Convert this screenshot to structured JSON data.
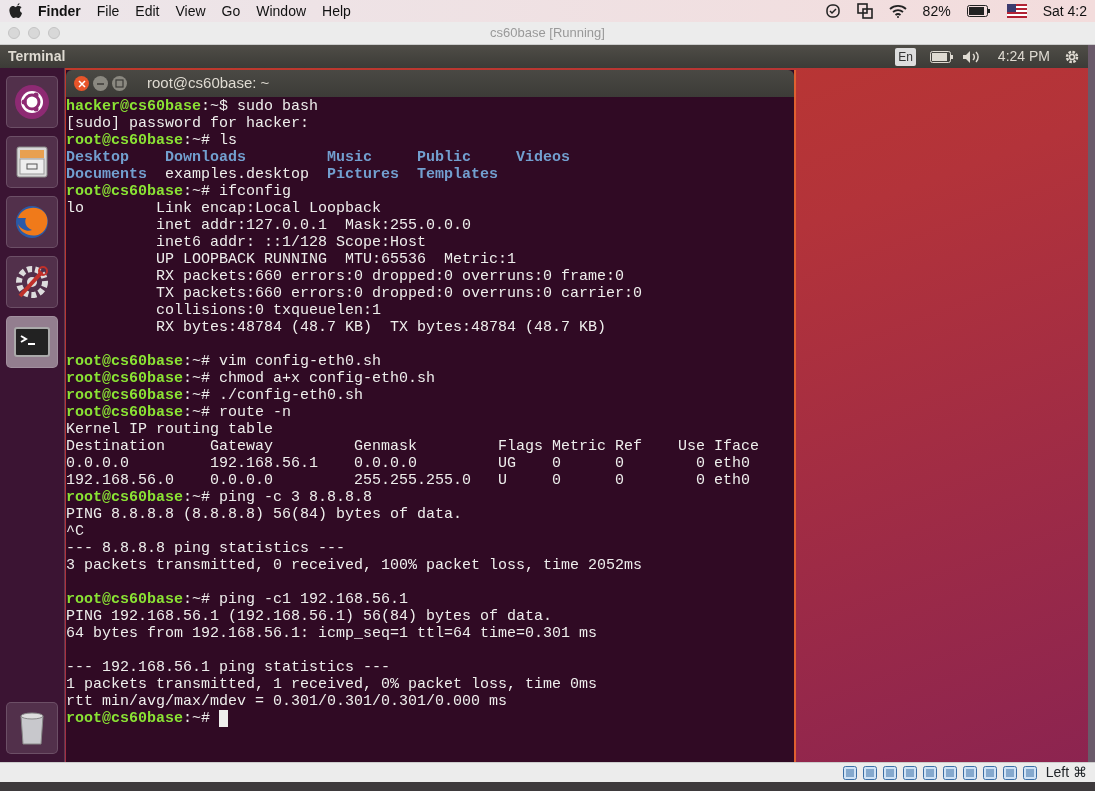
{
  "menubar": {
    "app": "Finder",
    "menus": [
      "File",
      "Edit",
      "View",
      "Go",
      "Window",
      "Help"
    ],
    "battery": "82%",
    "clock": "Sat 4:2"
  },
  "vm_window": {
    "title": "cs60base [Running]"
  },
  "top_panel": {
    "app": "Terminal",
    "keyboard": "En",
    "clock": "4:24 PM"
  },
  "launcher": [
    {
      "kind": "dash",
      "selected": false
    },
    {
      "kind": "files",
      "selected": false
    },
    {
      "kind": "browser",
      "selected": false
    },
    {
      "kind": "settings",
      "selected": false
    },
    {
      "kind": "terminal",
      "selected": true
    },
    {
      "kind": "trash",
      "selected": false
    }
  ],
  "terminal": {
    "title": "root@cs60base: ~",
    "lines": [
      {
        "kind": "prompt",
        "user": "hacker@cs60base",
        "text": ":~$ sudo bash"
      },
      {
        "kind": "output",
        "text": "[sudo] password for hacker:"
      },
      {
        "kind": "prompt",
        "user": "root@cs60base",
        "text": ":~# ls"
      },
      {
        "kind": "listing",
        "items": [
          {
            "text": "Desktop",
            "dir": true
          },
          {
            "text": "Downloads",
            "dir": true
          },
          {
            "text": "Music",
            "dir": true
          },
          {
            "text": "Public",
            "dir": true
          },
          {
            "text": "Videos",
            "dir": true
          }
        ]
      },
      {
        "kind": "listing",
        "items": [
          {
            "text": "Documents",
            "dir": true
          },
          {
            "text": "examples.desktop",
            "dir": false
          },
          {
            "text": "Pictures",
            "dir": true
          },
          {
            "text": "Templates",
            "dir": true
          }
        ]
      },
      {
        "kind": "prompt",
        "user": "root@cs60base",
        "text": ":~# ifconfig"
      },
      {
        "kind": "output",
        "text": "lo        Link encap:Local Loopback"
      },
      {
        "kind": "output",
        "text": "          inet addr:127.0.0.1  Mask:255.0.0.0"
      },
      {
        "kind": "output",
        "text": "          inet6 addr: ::1/128 Scope:Host"
      },
      {
        "kind": "output",
        "text": "          UP LOOPBACK RUNNING  MTU:65536  Metric:1"
      },
      {
        "kind": "output",
        "text": "          RX packets:660 errors:0 dropped:0 overruns:0 frame:0"
      },
      {
        "kind": "output",
        "text": "          TX packets:660 errors:0 dropped:0 overruns:0 carrier:0"
      },
      {
        "kind": "output",
        "text": "          collisions:0 txqueuelen:1"
      },
      {
        "kind": "output",
        "text": "          RX bytes:48784 (48.7 KB)  TX bytes:48784 (48.7 KB)"
      },
      {
        "kind": "blank"
      },
      {
        "kind": "prompt",
        "user": "root@cs60base",
        "text": ":~# vim config-eth0.sh"
      },
      {
        "kind": "prompt",
        "user": "root@cs60base",
        "text": ":~# chmod a+x config-eth0.sh"
      },
      {
        "kind": "prompt",
        "user": "root@cs60base",
        "text": ":~# ./config-eth0.sh"
      },
      {
        "kind": "prompt",
        "user": "root@cs60base",
        "text": ":~# route -n"
      },
      {
        "kind": "output",
        "text": "Kernel IP routing table"
      },
      {
        "kind": "output",
        "text": "Destination     Gateway         Genmask         Flags Metric Ref    Use Iface"
      },
      {
        "kind": "output",
        "text": "0.0.0.0         192.168.56.1    0.0.0.0         UG    0      0        0 eth0"
      },
      {
        "kind": "output",
        "text": "192.168.56.0    0.0.0.0         255.255.255.0   U     0      0        0 eth0"
      },
      {
        "kind": "prompt",
        "user": "root@cs60base",
        "text": ":~# ping -c 3 8.8.8.8"
      },
      {
        "kind": "output",
        "text": "PING 8.8.8.8 (8.8.8.8) 56(84) bytes of data."
      },
      {
        "kind": "output",
        "text": "^C"
      },
      {
        "kind": "output",
        "text": "--- 8.8.8.8 ping statistics ---"
      },
      {
        "kind": "output",
        "text": "3 packets transmitted, 0 received, 100% packet loss, time 2052ms"
      },
      {
        "kind": "blank"
      },
      {
        "kind": "prompt",
        "user": "root@cs60base",
        "text": ":~# ping -c1 192.168.56.1"
      },
      {
        "kind": "output",
        "text": "PING 192.168.56.1 (192.168.56.1) 56(84) bytes of data."
      },
      {
        "kind": "output",
        "text": "64 bytes from 192.168.56.1: icmp_seq=1 ttl=64 time=0.301 ms"
      },
      {
        "kind": "blank"
      },
      {
        "kind": "output",
        "text": "--- 192.168.56.1 ping statistics ---"
      },
      {
        "kind": "output",
        "text": "1 packets transmitted, 1 received, 0% packet loss, time 0ms"
      },
      {
        "kind": "output",
        "text": "rtt min/avg/max/mdev = 0.301/0.301/0.301/0.000 ms"
      },
      {
        "kind": "prompt",
        "user": "root@cs60base",
        "text": ":~#",
        "cursor": true
      }
    ]
  },
  "status_bar": {
    "host_key": "Left ⌘"
  }
}
